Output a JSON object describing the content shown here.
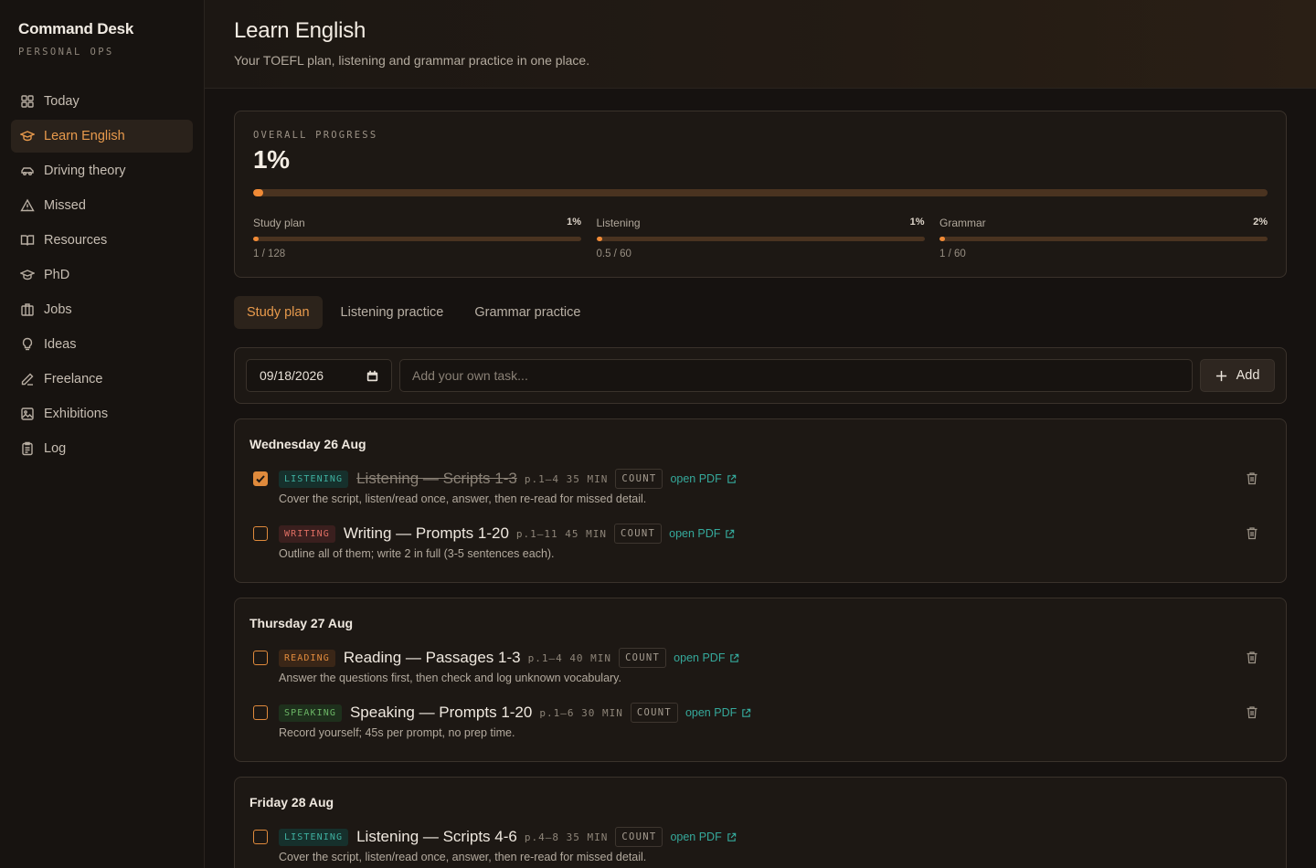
{
  "sidebar": {
    "brand": "Command Desk",
    "brand_sub": "PERSONAL OPS",
    "items": [
      {
        "label": "Today",
        "icon": "grid-icon"
      },
      {
        "label": "Learn English",
        "icon": "graduation-cap-icon",
        "active": true
      },
      {
        "label": "Driving theory",
        "icon": "car-icon"
      },
      {
        "label": "Missed",
        "icon": "warning-triangle-icon"
      },
      {
        "label": "Resources",
        "icon": "book-open-icon"
      },
      {
        "label": "PhD",
        "icon": "graduation-cap-icon"
      },
      {
        "label": "Jobs",
        "icon": "building-icon"
      },
      {
        "label": "Ideas",
        "icon": "lightbulb-icon"
      },
      {
        "label": "Freelance",
        "icon": "pen-icon"
      },
      {
        "label": "Exhibitions",
        "icon": "image-icon"
      },
      {
        "label": "Log",
        "icon": "clipboard-icon"
      }
    ]
  },
  "header": {
    "title": "Learn English",
    "subtitle": "Your TOEFL plan, listening and grammar practice in one place."
  },
  "progress": {
    "label": "OVERALL PROGRESS",
    "value": "1%",
    "fraction": 0.01,
    "subs": [
      {
        "name": "Study plan",
        "pct": "1%",
        "fraction": 0.008,
        "count": "1 / 128"
      },
      {
        "name": "Listening",
        "pct": "1%",
        "fraction": 0.008,
        "count": "0.5 / 60"
      },
      {
        "name": "Grammar",
        "pct": "2%",
        "fraction": 0.017,
        "count": "1 / 60"
      }
    ]
  },
  "tabs": [
    {
      "label": "Study plan",
      "active": true
    },
    {
      "label": "Listening practice"
    },
    {
      "label": "Grammar practice"
    }
  ],
  "add_form": {
    "date": "09/18/2026",
    "placeholder": "Add your own task...",
    "add_label": "Add"
  },
  "days": [
    {
      "title": "Wednesday 26 Aug",
      "tasks": [
        {
          "done": true,
          "tag": "LISTENING",
          "type": "listening",
          "title": "Listening — Scripts 1-3",
          "meta": "p.1–4 35 MIN",
          "count": "COUNT",
          "pdf": "open PDF",
          "desc": "Cover the script, listen/read once, answer, then re-read for missed detail."
        },
        {
          "done": false,
          "tag": "WRITING",
          "type": "writing",
          "title": "Writing — Prompts 1-20",
          "meta": "p.1–11 45 MIN",
          "count": "COUNT",
          "pdf": "open PDF",
          "desc": "Outline all of them; write 2 in full (3-5 sentences each)."
        }
      ]
    },
    {
      "title": "Thursday 27 Aug",
      "tasks": [
        {
          "done": false,
          "tag": "READING",
          "type": "reading",
          "title": "Reading — Passages 1-3",
          "meta": "p.1–4 40 MIN",
          "count": "COUNT",
          "pdf": "open PDF",
          "desc": "Answer the questions first, then check and log unknown vocabulary."
        },
        {
          "done": false,
          "tag": "SPEAKING",
          "type": "speaking",
          "title": "Speaking — Prompts 1-20",
          "meta": "p.1–6 30 MIN",
          "count": "COUNT",
          "pdf": "open PDF",
          "desc": "Record yourself; 45s per prompt, no prep time."
        }
      ]
    },
    {
      "title": "Friday 28 Aug",
      "tasks": [
        {
          "done": false,
          "tag": "LISTENING",
          "type": "listening",
          "title": "Listening — Scripts 4-6",
          "meta": "p.4–8 35 MIN",
          "count": "COUNT",
          "pdf": "open PDF",
          "desc": "Cover the script, listen/read once, answer, then re-read for missed detail."
        }
      ]
    }
  ]
}
